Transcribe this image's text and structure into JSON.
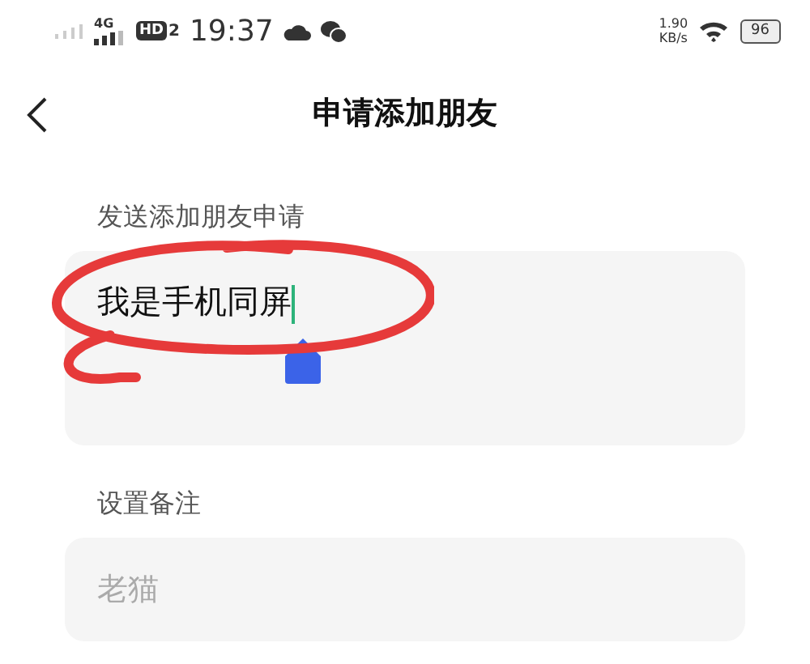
{
  "status_bar": {
    "network": "4G",
    "hd": "HD",
    "hd_sub": "2",
    "time": "19:37",
    "speed": "1.90",
    "speed_unit": "KB/s",
    "battery": "96"
  },
  "header": {
    "title": "申请添加朋友"
  },
  "fields": [
    {
      "kind": "textarea",
      "label": "发送添加朋友申请",
      "value": "我是手机同屏",
      "focused": true
    },
    {
      "kind": "input",
      "label": "设置备注",
      "placeholder": "老猫"
    }
  ]
}
